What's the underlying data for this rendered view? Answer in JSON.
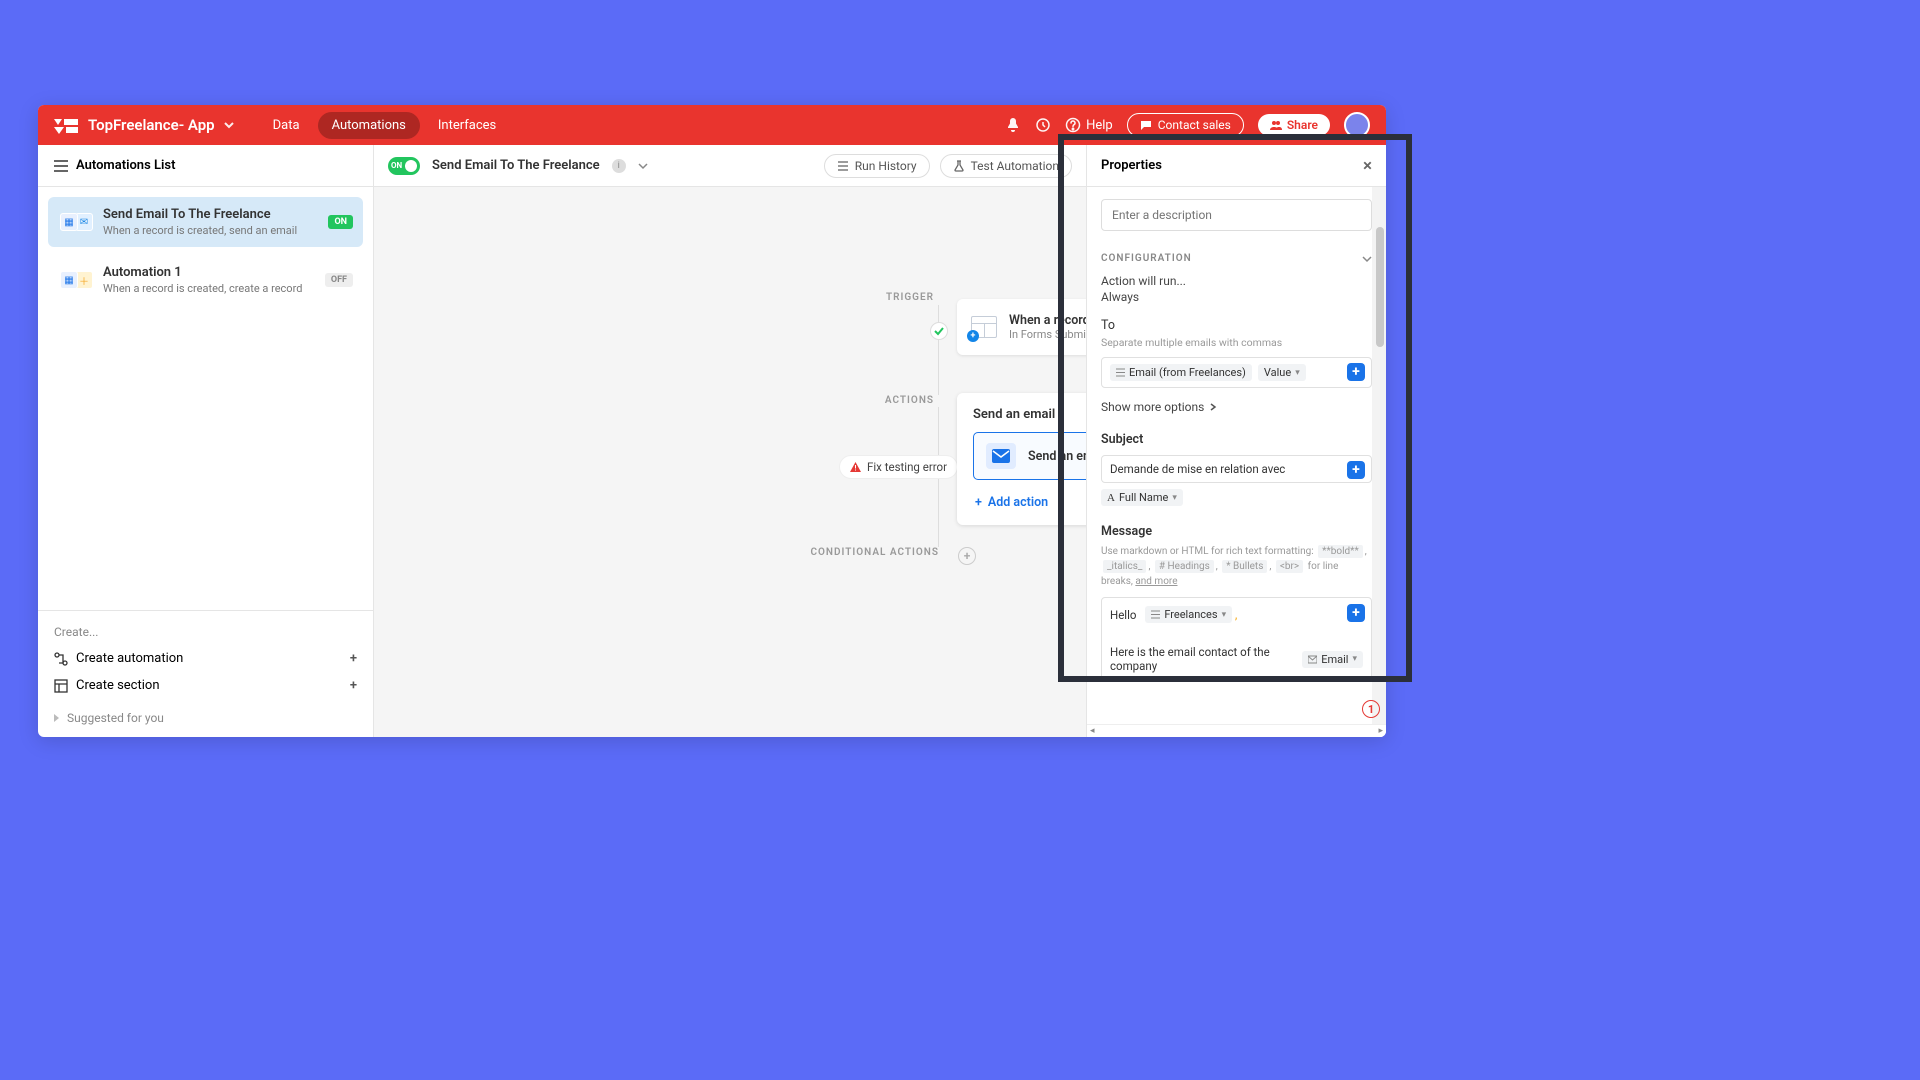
{
  "topbar": {
    "app_title": "TopFreelance- App",
    "nav": {
      "data": "Data",
      "automations": "Automations",
      "interfaces": "Interfaces"
    },
    "help": "Help",
    "contact": "Contact sales",
    "share": "Share"
  },
  "sidebar": {
    "header": "Automations List",
    "items": [
      {
        "title": "Send Email To The Freelance",
        "desc": "When a record is created, send an email",
        "status": "ON"
      },
      {
        "title": "Automation 1",
        "desc": "When a record is created, create a record",
        "status": "OFF"
      }
    ],
    "create_label": "Create...",
    "create_automation": "Create automation",
    "create_section": "Create section",
    "suggested": "Suggested for you"
  },
  "canvas": {
    "toolbar": {
      "toggle": "ON",
      "title": "Send Email To The Freelance",
      "run_history": "Run History",
      "test_automation": "Test Automation"
    },
    "labels": {
      "trigger": "TRIGGER",
      "actions": "ACTIONS",
      "conditional": "CONDITIONAL ACTIONS"
    },
    "trigger": {
      "title": "When a record is created",
      "sub": "In Forms Submission"
    },
    "action_card": {
      "title": "Send an email",
      "row_name": "Send an email",
      "add_action": "Add action"
    },
    "fix_error": "Fix testing error"
  },
  "props": {
    "header": "Properties",
    "desc_placeholder": "Enter a description",
    "config": "CONFIGURATION",
    "action_will_run": "Action will run...",
    "always": "Always",
    "to": "To",
    "to_help": "Separate multiple emails with commas",
    "email_token": "Email (from Freelances)",
    "value_token": "Value",
    "show_more": "Show more options",
    "subject": "Subject",
    "subject_value": "Demande de mise en relation avec",
    "fullname_token": "Full Name",
    "message": "Message",
    "msg_help_prefix": "Use markdown or HTML for rich text formatting:",
    "msg_help_bold": "**bold**",
    "msg_help_italics": "_italics_",
    "msg_help_headings": "# Headings",
    "msg_help_bullets": "* Bullets",
    "msg_help_br": "<br>",
    "msg_help_breaks": "for line breaks,",
    "msg_help_more": "and more",
    "hello": "Hello",
    "freelances_token": "Freelances",
    "contact_line": "Here is the email contact of the company",
    "email2_token": "Email",
    "err_count": "1"
  }
}
